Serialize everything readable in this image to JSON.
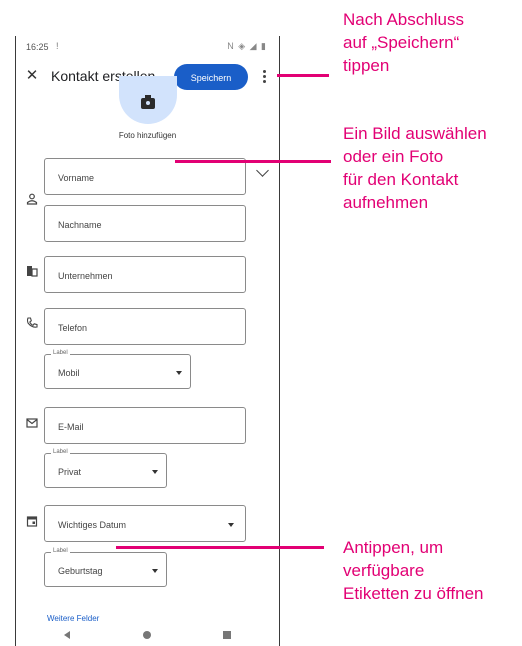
{
  "status_bar": {
    "time": "16:25",
    "notification": "!",
    "icons": "N ◈ ◢ ▮"
  },
  "app_bar": {
    "title": "Kontakt erstellen",
    "save_label": "Speichern"
  },
  "photo": {
    "add_label": "Foto hinzufügen"
  },
  "fields": {
    "first_name": "Vorname",
    "last_name": "Nachname",
    "company": "Unternehmen",
    "phone": "Telefon",
    "phone_label": {
      "caption": "Label",
      "value": "Mobil"
    },
    "email": "E-Mail",
    "email_label": {
      "caption": "Label",
      "value": "Privat"
    },
    "date": "Wichtiges Datum",
    "date_label": {
      "caption": "Label",
      "value": "Geburtstag"
    }
  },
  "more_fields": "Weitere Felder",
  "callouts": {
    "save": "Nach Abschluss\nauf „Speichern“\ntippen",
    "photo": "Ein Bild auswählen\noder ein Foto\nfür den Kontakt\naufnehmen",
    "label": "Antippen, um\nverfügbare\nEtiketten zu öffnen"
  },
  "colors": {
    "accent": "#1a5ec8",
    "callout": "#e20074",
    "photo_bg": "#d2e3fc"
  }
}
